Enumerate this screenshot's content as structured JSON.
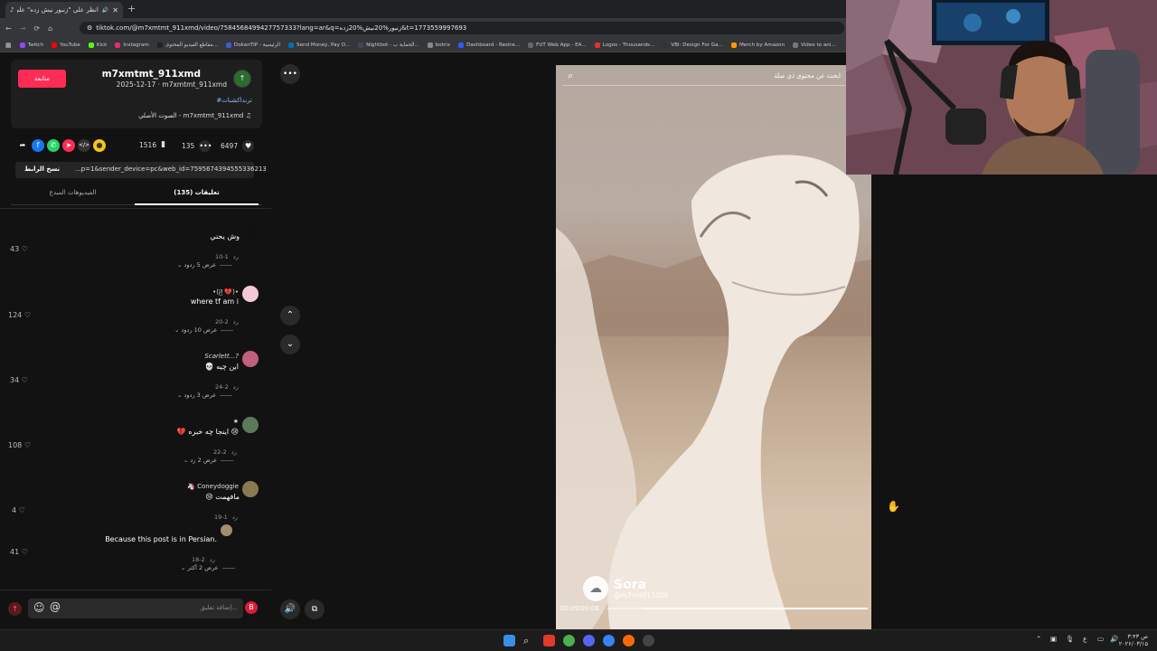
{
  "browser": {
    "tab_title": "انظر علي \"زنبور نيش زده\" على...",
    "tab_audio": "🔊",
    "url": "tiktok.com/@m7xmtmt_911xmd/video/7584568499427757333?lang=ar&q=زنبور%20نیش%20زده&t=1773559997693",
    "bookmarks": [
      {
        "label": "Twitch",
        "color": "#9146ff"
      },
      {
        "label": "YouTube",
        "color": "#ff0000"
      },
      {
        "label": "Kick",
        "color": "#53fc18"
      },
      {
        "label": "Instagram",
        "color": "#e1306c"
      },
      {
        "label": "مقاطع الفيديو المحتوى...",
        "color": "#222"
      },
      {
        "label": "DokanTIP - الرئيسية",
        "color": "#3a5fcd"
      },
      {
        "label": "Send Money, Pay O...",
        "color": "#0070ba"
      },
      {
        "label": "Nightbot - الحماية ب...",
        "color": "#445"
      },
      {
        "label": "botrix",
        "color": "#888"
      },
      {
        "label": "Dashboard - Restre...",
        "color": "#2d5bff"
      },
      {
        "label": "FUT Web App - EA...",
        "color": "#666"
      },
      {
        "label": "Logos - Thousands...",
        "color": "#d33"
      },
      {
        "label": "VBI: Design For Ga...",
        "color": "#333"
      },
      {
        "label": "Merch by Amazon",
        "color": "#f90"
      },
      {
        "label": "Video to ani...",
        "color": "#777"
      }
    ]
  },
  "post": {
    "follow_label": "متابعة",
    "username": "m7xmtmt_911xmd",
    "date_line": "2025-12-17 · m7xmtmt_911xmd",
    "hashtag": "#ترنداكشنات",
    "sound": "الصوت الأصلي - m7xmtmt_911xmd",
    "likes": "6497",
    "comments": "135",
    "saves": "1516",
    "copy_label": "نسخ الرابط",
    "link": "...p=1&sender_device=pc&web_id=7595674394555336213",
    "tab_comments": "تعليقات (135)",
    "tab_creator_videos": "الفيديوهات المبدع"
  },
  "comments": [
    {
      "name": "",
      "text": "وش يحني",
      "date": "1-10",
      "reply": "رد",
      "likes": "43",
      "replies": "عرض 5 ردود",
      "avatar": "#111"
    },
    {
      "name": "•(ジ̷ 💔)•",
      "text": "where tf am i",
      "date": "2-20",
      "reply": "رد",
      "likes": "124",
      "replies": "عرض 10 ردود",
      "avatar": "#f4c8d8"
    },
    {
      "name": "Scarlett...?",
      "text": "💀 این چیه",
      "date": "2-24",
      "reply": "رد",
      "likes": "34",
      "replies": "عرض 3 ردود",
      "avatar": "#c0607a"
    },
    {
      "name": "★",
      "text": "💔 اینجا چه خبره 😢",
      "date": "2-22",
      "reply": "رد",
      "likes": "108",
      "replies": "عرض 2 رد",
      "avatar": "#5a7a5a"
    },
    {
      "name": "🦄 Coneydoggie",
      "text": "😢 مافهمت",
      "date": "1-19",
      "reply": "رد",
      "likes": "4",
      "replies": "",
      "avatar": "#8a7a50"
    },
    {
      "name": "",
      "text": "Because this post is in Persian.",
      "date": "2-18",
      "reply": "رد",
      "likes": "41",
      "replies": "عرض 2 أكثر",
      "avatar": "#a09070"
    }
  ],
  "comment_input": {
    "placeholder": "إضافة تعليق...",
    "emoji_icon": "☺",
    "at_icon": "@"
  },
  "video": {
    "search_placeholder": "ابحث عن محتوى ذي صلة",
    "watermark_title": "Sora",
    "watermark_handle": "@m7md911000",
    "time": "00:09/00:08",
    "progress": 0.14
  },
  "taskbar": {
    "clock_time": "۳:۴۳ ص",
    "clock_date": "۲۰۲۶/۰۳/۱۵",
    "lang": "ع"
  },
  "colors": {
    "accent": "#fe2c55",
    "background": "#121212"
  }
}
